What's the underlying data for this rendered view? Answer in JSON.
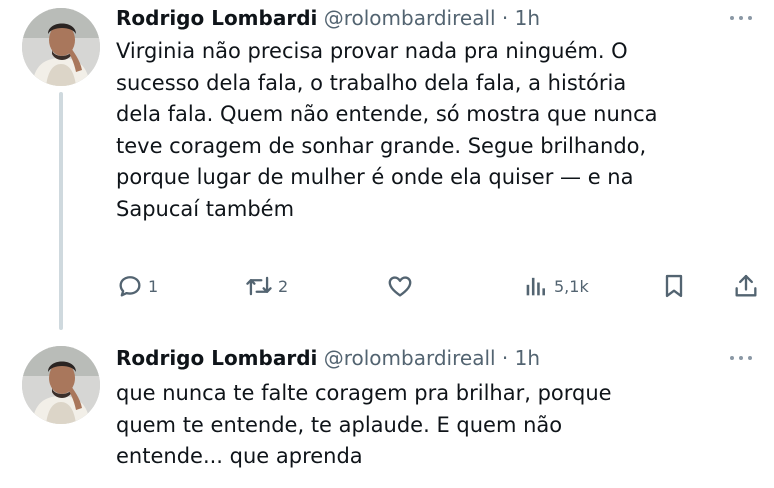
{
  "tweets": [
    {
      "author_name": "Rodrigo Lombardi",
      "handle": "@rolombardireall",
      "separator": "·",
      "time": "1h",
      "text": "Virginia não precisa provar nada pra ninguém. O\nsucesso dela fala, o trabalho dela fala, a história\ndela fala. Quem não entende, só mostra que nunca\nteve coragem de sonhar grande. Segue brilhando,\nporque lugar de mulher é onde ela quiser — e na\nSapucaí também",
      "replies": "1",
      "retweets": "2",
      "views": "5,1k"
    },
    {
      "author_name": "Rodrigo Lombardi",
      "handle": "@rolombardireall",
      "separator": "·",
      "time": "1h",
      "text": "que nunca te falte coragem pra brilhar, porque\nquem te entende, te aplaude. E quem não\nentende... que aprenda"
    }
  ],
  "icons": {
    "reply": "reply-icon",
    "retweet": "retweet-icon",
    "like": "like-icon",
    "views": "views-icon",
    "bookmark": "bookmark-icon",
    "share": "share-icon",
    "more": "more-icon"
  },
  "colors": {
    "text_primary": "#0f1419",
    "text_secondary": "#536471",
    "thread_line": "#cfd9de"
  }
}
